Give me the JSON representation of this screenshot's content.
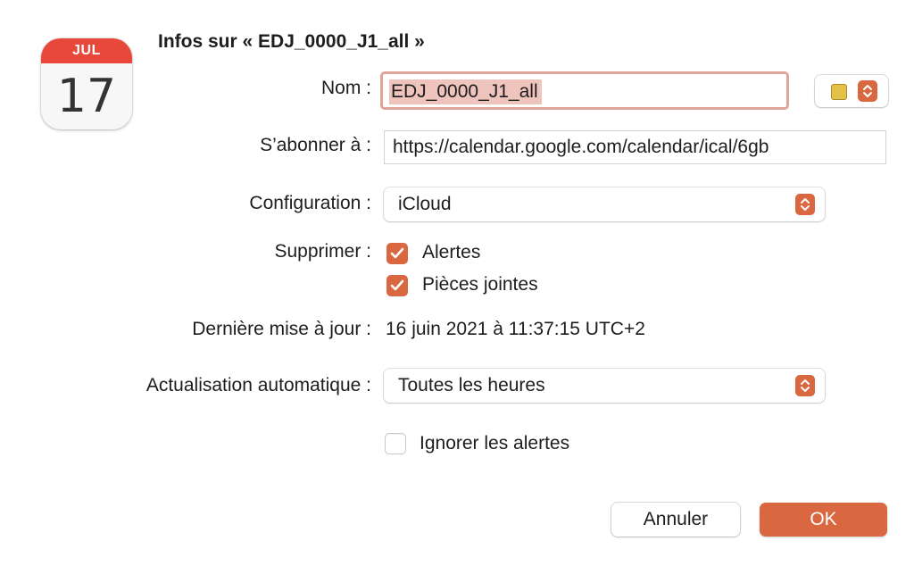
{
  "app_icon": {
    "month": "JUL",
    "day": "17"
  },
  "dialog": {
    "title": "Infos sur « EDJ_0000_J1_all »",
    "name_label": "Nom :",
    "name_value": "EDJ_0000_J1_all",
    "subscribe_label": "S’abonner à :",
    "subscribe_value": "https://calendar.google.com/calendar/ical/6gb",
    "configuration_label": "Configuration :",
    "configuration_value": "iCloud",
    "delete_label": "Supprimer :",
    "alerts_label": "Alertes",
    "attachments_label": "Pièces jointes",
    "last_update_label": "Dernière mise à jour :",
    "last_update_value": "16 juin 2021 à 11:37:15 UTC+2",
    "auto_refresh_label": "Actualisation automatique :",
    "auto_refresh_value": "Toutes les heures",
    "ignore_alerts_label": "Ignorer les alertes",
    "cancel_label": "Annuler",
    "ok_label": "OK"
  },
  "state": {
    "alerts_checked": true,
    "attachments_checked": true,
    "ignore_alerts_checked": false
  },
  "colors": {
    "accent": "#d9673f",
    "calendar_color": "#e6c14a"
  },
  "icons": {
    "stepper": "chevron-up-down-icon",
    "checkmark": "checkmark-icon"
  }
}
